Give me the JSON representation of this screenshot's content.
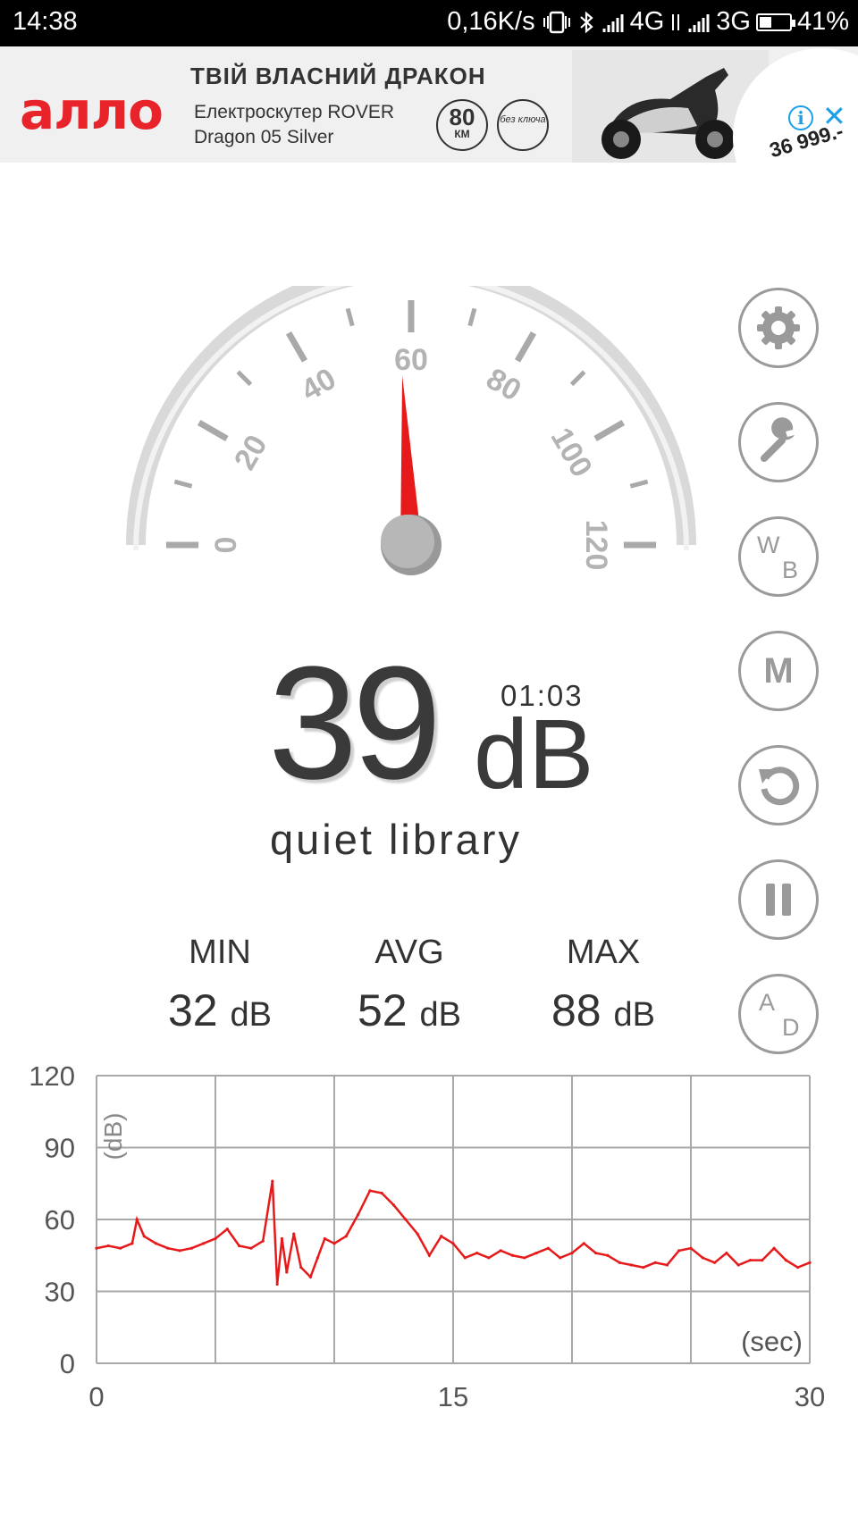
{
  "status_bar": {
    "time": "14:38",
    "net_speed": "0,16K/s",
    "net1": "4G",
    "net2": "3G",
    "battery": "41%",
    "battery_level": 0.41
  },
  "ad": {
    "brand": "аллo",
    "headline": "ТВІЙ ВЛАСНИЙ ДРАКОН",
    "line1": "Електроскутер ROVER",
    "line2": "Dragon 05 Silver",
    "badge1_big": "80",
    "badge1_small": "КМ",
    "badge2": "без ключа",
    "price": "36 999.-",
    "info_icon": "i",
    "close_icon": "✕"
  },
  "gauge": {
    "min": 0,
    "max": 120,
    "labels": [
      "0",
      "20",
      "40",
      "60",
      "80",
      "100",
      "120"
    ],
    "value": 58
  },
  "reading": {
    "value": "39",
    "unit": "dB",
    "timer": "01:03",
    "description": "quiet library"
  },
  "stats": [
    {
      "label": "MIN",
      "value": "32",
      "unit": "dB"
    },
    {
      "label": "AVG",
      "value": "52",
      "unit": "dB"
    },
    {
      "label": "MAX",
      "value": "88",
      "unit": "dB"
    }
  ],
  "side_buttons": [
    {
      "name": "settings",
      "icon": "gear-icon"
    },
    {
      "name": "tools",
      "icon": "wrench-icon"
    },
    {
      "name": "weighting",
      "main": "W",
      "sub": "B"
    },
    {
      "name": "mode",
      "main": "M"
    },
    {
      "name": "reset",
      "icon": "reset-icon"
    },
    {
      "name": "pause",
      "icon": "pause-icon"
    },
    {
      "name": "ad-toggle",
      "main": "A",
      "sub": "D"
    }
  ],
  "chart_data": {
    "type": "line",
    "ylabel": "(dB)",
    "xlabel": "(sec)",
    "xlim": [
      0,
      30
    ],
    "ylim": [
      0,
      120
    ],
    "x_ticks": [
      "0",
      "15",
      "30"
    ],
    "y_ticks": [
      "120",
      "90",
      "60",
      "30",
      "0"
    ],
    "grid": true,
    "line_color": "#e61a1a",
    "x": [
      0,
      0.5,
      1,
      1.5,
      1.7,
      2,
      2.5,
      3,
      3.5,
      4,
      4.5,
      5,
      5.5,
      6,
      6.5,
      7,
      7.4,
      7.6,
      7.8,
      8,
      8.3,
      8.6,
      9,
      9.3,
      9.6,
      10,
      10.5,
      11,
      11.5,
      12,
      12.5,
      13,
      13.5,
      14,
      14.5,
      15,
      15.5,
      16,
      16.5,
      17,
      17.5,
      18,
      18.5,
      19,
      19.5,
      20,
      20.5,
      21,
      21.5,
      22,
      22.5,
      23,
      23.5,
      24,
      24.5,
      25,
      25.5,
      26,
      26.5,
      27,
      27.5,
      28,
      28.5,
      29,
      29.5,
      30
    ],
    "values": [
      48,
      49,
      48,
      50,
      60,
      53,
      50,
      48,
      47,
      48,
      50,
      52,
      56,
      49,
      48,
      51,
      76,
      33,
      52,
      38,
      54,
      40,
      36,
      44,
      52,
      50,
      53,
      62,
      72,
      71,
      66,
      60,
      54,
      45,
      53,
      50,
      44,
      46,
      44,
      47,
      45,
      44,
      46,
      48,
      44,
      46,
      50,
      46,
      45,
      42,
      41,
      40,
      42,
      41,
      47,
      48,
      44,
      42,
      46,
      41,
      43,
      43,
      48,
      43,
      40,
      42
    ]
  }
}
